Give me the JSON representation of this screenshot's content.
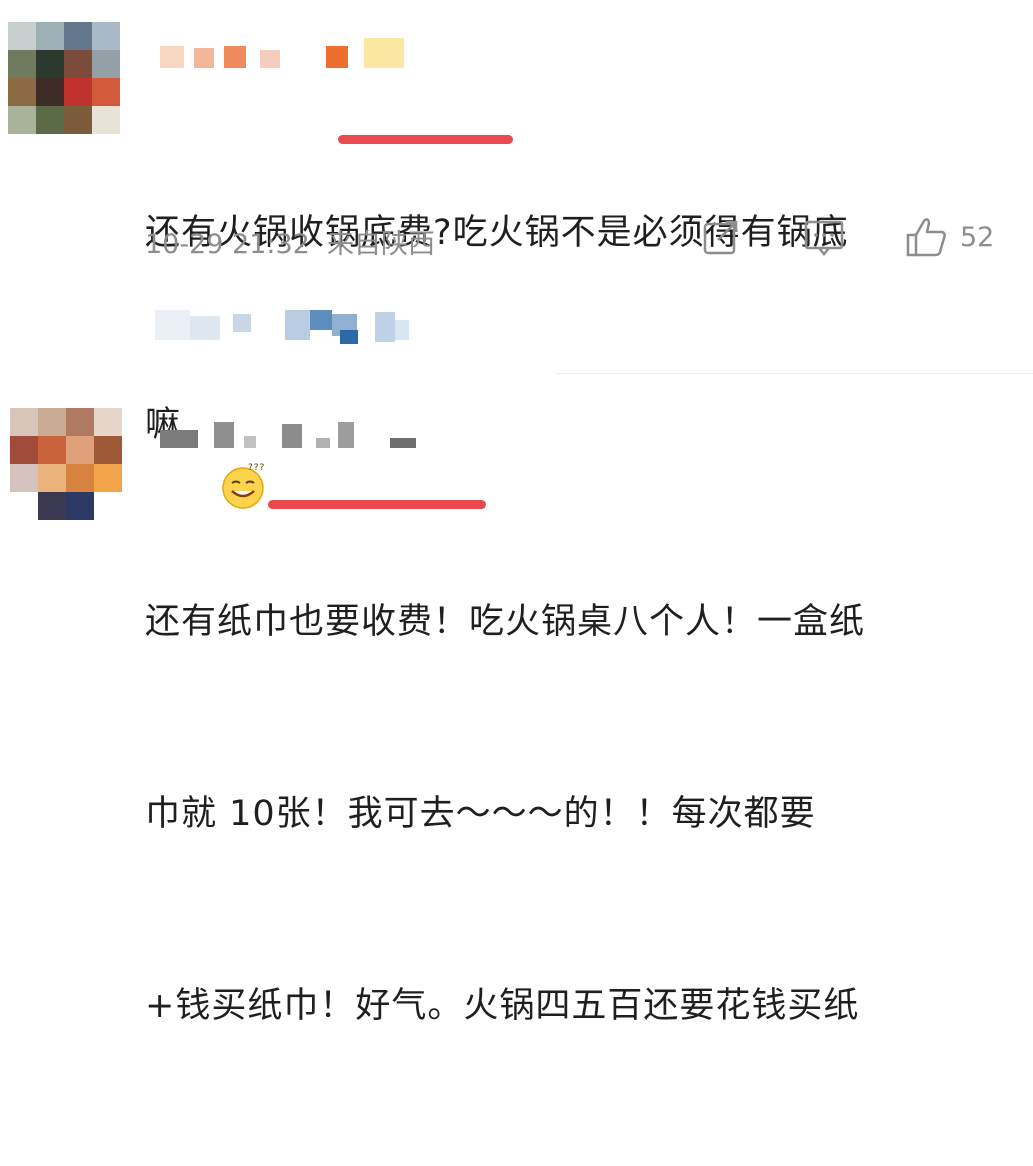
{
  "comment1": {
    "text_line1": "还有火锅收锅底费?吃火锅不是必须得有锅底",
    "text_line2": "嘛",
    "emoji_icon": "grinning-sweat-face-icon",
    "timestamp": "10-29 21:32",
    "location": "来自陕西",
    "like_count": "52",
    "underline_color": "#e84a4f"
  },
  "comment2": {
    "text_line1": "还有纸巾也要收费！吃火锅桌八个人！一盒纸",
    "text_line2": "巾就 10张！我可去～～～的！！每次都要",
    "text_line3": "+钱买纸巾！好气。火锅四五百还要花钱买纸",
    "underline_color": "#e84a4f"
  },
  "actions": {
    "share_icon": "share-icon",
    "comment_icon": "comment-icon",
    "like_icon": "thumbs-up-icon"
  },
  "colors": {
    "text": "#1f1f1f",
    "meta": "#8d8d8d",
    "highlight": "#e84a4f"
  }
}
